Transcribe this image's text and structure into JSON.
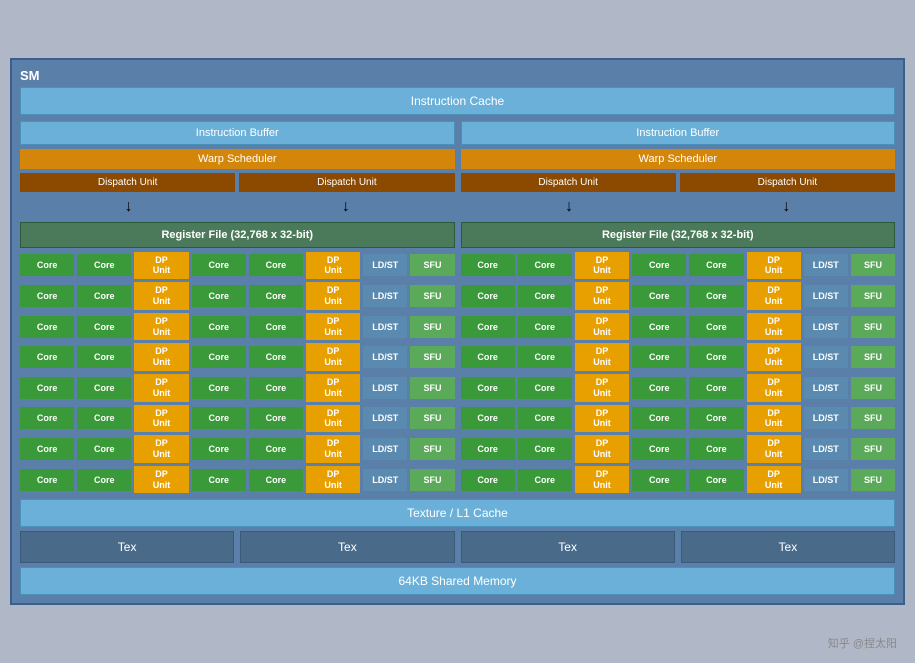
{
  "sm": {
    "label": "SM",
    "instruction_cache": "Instruction Cache",
    "halves": [
      {
        "instruction_buffer": "Instruction Buffer",
        "warp_scheduler": "Warp Scheduler",
        "dispatch_unit_1": "Dispatch Unit",
        "dispatch_unit_2": "Dispatch Unit",
        "register_file": "Register File (32,768 x 32-bit)",
        "rows": [
          [
            "Core",
            "Core",
            "DP\nUnit",
            "Core",
            "Core",
            "DP\nUnit",
            "LD/ST",
            "SFU"
          ],
          [
            "Core",
            "Core",
            "DP\nUnit",
            "Core",
            "Core",
            "DP\nUnit",
            "LD/ST",
            "SFU"
          ],
          [
            "Core",
            "Core",
            "DP\nUnit",
            "Core",
            "Core",
            "DP\nUnit",
            "LD/ST",
            "SFU"
          ],
          [
            "Core",
            "Core",
            "DP\nUnit",
            "Core",
            "Core",
            "DP\nUnit",
            "LD/ST",
            "SFU"
          ],
          [
            "Core",
            "Core",
            "DP\nUnit",
            "Core",
            "Core",
            "DP\nUnit",
            "LD/ST",
            "SFU"
          ],
          [
            "Core",
            "Core",
            "DP\nUnit",
            "Core",
            "Core",
            "DP\nUnit",
            "LD/ST",
            "SFU"
          ],
          [
            "Core",
            "Core",
            "DP\nUnit",
            "Core",
            "Core",
            "DP\nUnit",
            "LD/ST",
            "SFU"
          ],
          [
            "Core",
            "Core",
            "DP\nUnit",
            "Core",
            "Core",
            "DP\nUnit",
            "LD/ST",
            "SFU"
          ]
        ]
      },
      {
        "instruction_buffer": "Instruction Buffer",
        "warp_scheduler": "Warp Scheduler",
        "dispatch_unit_1": "Dispatch Unit",
        "dispatch_unit_2": "Dispatch Unit",
        "register_file": "Register File (32,768 x 32-bit)",
        "rows": [
          [
            "Core",
            "Core",
            "DP\nUnit",
            "Core",
            "Core",
            "DP\nUnit",
            "LD/ST",
            "SFU"
          ],
          [
            "Core",
            "Core",
            "DP\nUnit",
            "Core",
            "Core",
            "DP\nUnit",
            "LD/ST",
            "SFU"
          ],
          [
            "Core",
            "Core",
            "DP\nUnit",
            "Core",
            "Core",
            "DP\nUnit",
            "LD/ST",
            "SFU"
          ],
          [
            "Core",
            "Core",
            "DP\nUnit",
            "Core",
            "Core",
            "DP\nUnit",
            "LD/ST",
            "SFU"
          ],
          [
            "Core",
            "Core",
            "DP\nUnit",
            "Core",
            "Core",
            "DP\nUnit",
            "LD/ST",
            "SFU"
          ],
          [
            "Core",
            "Core",
            "DP\nUnit",
            "Core",
            "Core",
            "DP\nUnit",
            "LD/ST",
            "SFU"
          ],
          [
            "Core",
            "Core",
            "DP\nUnit",
            "Core",
            "Core",
            "DP\nUnit",
            "LD/ST",
            "SFU"
          ],
          [
            "Core",
            "Core",
            "DP\nUnit",
            "Core",
            "Core",
            "DP\nUnit",
            "LD/ST",
            "SFU"
          ]
        ]
      }
    ],
    "texture_l1_cache": "Texture / L1 Cache",
    "tex_units": [
      "Tex",
      "Tex",
      "Tex",
      "Tex"
    ],
    "shared_memory": "64KB Shared Memory",
    "watermark": "知乎 @捏太阳"
  }
}
